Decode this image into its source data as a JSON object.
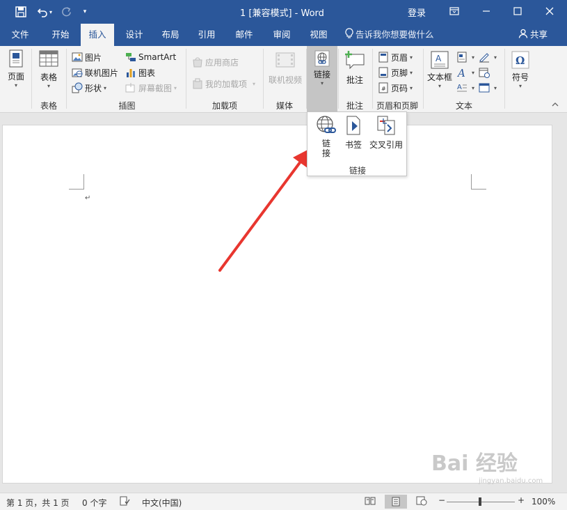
{
  "title_bar": {
    "doc_title": "1 [兼容模式]  -  Word",
    "signin": "登录",
    "icons": [
      "save-icon",
      "undo-icon",
      "redo-icon",
      "customize-qat-icon"
    ]
  },
  "menu": {
    "tabs": [
      "文件",
      "开始",
      "插入",
      "设计",
      "布局",
      "引用",
      "邮件",
      "审阅",
      "视图"
    ],
    "active_tab": "插入",
    "tell_me": "告诉我你想要做什么",
    "share": "共享"
  },
  "ribbon": {
    "pages": {
      "button": "页面",
      "group": ""
    },
    "tables": {
      "button": "表格",
      "group": "表格"
    },
    "illustrations": {
      "group": "插图",
      "picture": "图片",
      "online_picture": "联机图片",
      "shapes": "形状",
      "smartart": "SmartArt",
      "chart": "图表",
      "screenshot": "屏幕截图"
    },
    "addins": {
      "group": "加载项",
      "store": "应用商店",
      "my_addins": "我的加载项"
    },
    "media": {
      "group": "媒体",
      "online_video": "联机视频"
    },
    "links": {
      "button": "链接"
    },
    "comments": {
      "group": "批注",
      "button": "批注"
    },
    "header_footer": {
      "group": "页眉和页脚",
      "header": "页眉",
      "footer": "页脚",
      "page_number": "页码"
    },
    "text": {
      "group": "文本",
      "textbox": "文本框"
    },
    "symbols": {
      "button": "符号"
    }
  },
  "links_dropdown": {
    "items": [
      "链\n接",
      "书签",
      "交叉引用"
    ],
    "group_label": "链接"
  },
  "status_bar": {
    "page": "第 1 页，共 1 页",
    "words": "0 个字",
    "language": "中文(中国)",
    "zoom": "100%"
  },
  "colors": {
    "brand": "#2b579a",
    "annotation_arrow": "#e8362f"
  },
  "watermark": {
    "text": "Bai 经验",
    "sub": "jingyan.baidu.com"
  }
}
